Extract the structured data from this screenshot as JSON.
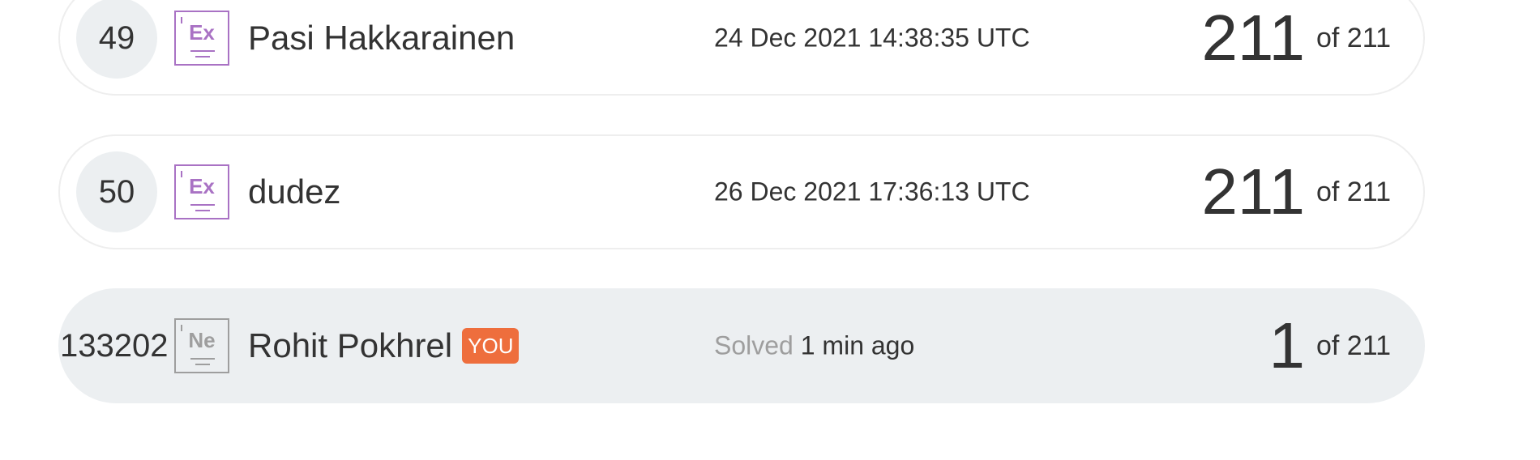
{
  "rows": [
    {
      "rank": "49",
      "level_symbol": "Ex",
      "level_icon": "element-tile-icon",
      "name": "Pasi Hakkarainen",
      "time": "24 Dec 2021 14:38:35 UTC",
      "solved": "211",
      "total": "of 211"
    },
    {
      "rank": "50",
      "level_symbol": "Ex",
      "level_icon": "element-tile-icon",
      "name": "dudez",
      "time": "26 Dec 2021 17:36:13 UTC",
      "solved": "211",
      "total": "of 211"
    },
    {
      "rank": "133202",
      "level_symbol": "Ne",
      "level_icon": "element-tile-icon",
      "name": "Rohit Pokhrel",
      "badge": "YOU",
      "time_prefix": "Solved",
      "time": "1 min ago",
      "solved": "1",
      "total": "of 211"
    }
  ],
  "colors": {
    "level_purple": "#a972c4",
    "level_grey": "#9e9e9e",
    "you_badge": "#ee6e3d",
    "you_row_bg": "#eceff1"
  }
}
